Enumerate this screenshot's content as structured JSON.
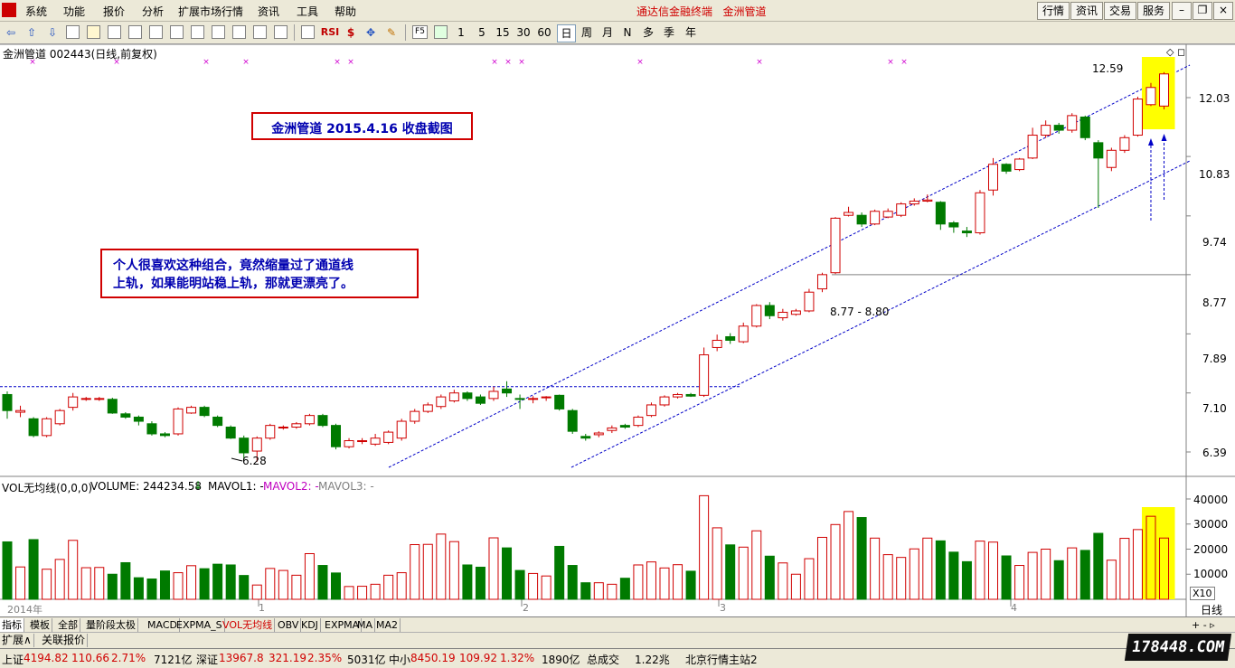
{
  "menu": [
    "系统",
    "功能",
    "报价",
    "分析",
    "扩展市场行情",
    "资讯",
    "工具",
    "帮助"
  ],
  "app_title": "通达信金融终端",
  "stock_title": "金洲管道",
  "right_buttons": [
    "行情",
    "资讯",
    "交易",
    "服务"
  ],
  "toolbar": {
    "periods": [
      "1",
      "5",
      "15",
      "30",
      "60",
      "日",
      "周",
      "月",
      "N",
      "多",
      "季",
      "年"
    ],
    "active_period": "日",
    "indicator_icon_label": "RSI",
    "f5_label": "F5"
  },
  "chart": {
    "header": "金洲管道 002443(日线,前复权)",
    "annotation_title": "金洲管道  2015.4.16  收盘截图",
    "annotation_comment_line1": "个人很喜欢这种组合，竟然缩量过了通道线",
    "annotation_comment_line2": "上轨，如果能明站稳上轨，那就更漂亮了。",
    "high_label": "12.59",
    "low_label": "6.28",
    "gap_label": "8.77 - 8.80",
    "price_ticks": [
      "12.03",
      "10.83",
      "9.74",
      "8.77",
      "7.89",
      "7.10",
      "6.39"
    ],
    "volume_header": "VOL无均线(0,0,0)",
    "volume_value_label": "VOLUME: 244234.58",
    "mavol1": "MAVOL1: -",
    "mavol2": "MAVOL2: -",
    "mavol3": "MAVOL3: -",
    "volume_ticks": [
      "40000",
      "30000",
      "20000",
      "10000"
    ],
    "vol_unit": "X10",
    "x_labels": [
      "2014年",
      "1",
      "2",
      "3",
      "4"
    ],
    "period_label": "日线"
  },
  "chart_data": {
    "type": "candlestick",
    "title": "金洲管道 002443(日线,前复权)",
    "price_axis_ticks": [
      12.03,
      10.83,
      9.74,
      8.77,
      7.89,
      7.1,
      6.39
    ],
    "volume_axis_ticks": [
      40000,
      30000,
      20000,
      10000
    ],
    "x_labels": [
      "2014年",
      "1",
      "2",
      "3",
      "4"
    ],
    "high": 12.59,
    "low": 6.28,
    "candles": [
      [
        7.08,
        6.88,
        7.12,
        6.78,
        22900
      ],
      [
        6.86,
        6.88,
        6.94,
        6.8,
        12900
      ],
      [
        6.78,
        6.58,
        6.8,
        6.56,
        23800
      ],
      [
        6.58,
        6.78,
        6.8,
        6.56,
        12000
      ],
      [
        6.72,
        6.88,
        6.9,
        6.7,
        15900
      ],
      [
        6.92,
        7.05,
        7.1,
        6.88,
        23500
      ],
      [
        7.03,
        7.03,
        7.05,
        7.0,
        12600
      ],
      [
        7.03,
        7.03,
        7.05,
        7.0,
        12700
      ],
      [
        7.02,
        6.85,
        7.04,
        6.84,
        10000
      ],
      [
        6.84,
        6.8,
        6.86,
        6.78,
        14600
      ],
      [
        6.8,
        6.75,
        6.82,
        6.7,
        8600
      ],
      [
        6.72,
        6.6,
        6.75,
        6.58,
        8100
      ],
      [
        6.6,
        6.58,
        6.62,
        6.56,
        11300
      ],
      [
        6.6,
        6.9,
        6.92,
        6.58,
        10600
      ],
      [
        6.85,
        6.92,
        6.94,
        6.84,
        13400
      ],
      [
        6.92,
        6.82,
        6.94,
        6.8,
        12200
      ],
      [
        6.8,
        6.7,
        6.82,
        6.68,
        14000
      ],
      [
        6.68,
        6.55,
        6.7,
        6.54,
        13700
      ],
      [
        6.55,
        6.38,
        6.58,
        6.3,
        9500
      ],
      [
        6.4,
        6.55,
        6.57,
        6.28,
        5700
      ],
      [
        6.55,
        6.7,
        6.72,
        6.53,
        12300
      ],
      [
        6.68,
        6.68,
        6.7,
        6.65,
        11500
      ],
      [
        6.68,
        6.72,
        6.74,
        6.66,
        9600
      ],
      [
        6.72,
        6.82,
        6.84,
        6.7,
        18200
      ],
      [
        6.82,
        6.7,
        6.84,
        6.68,
        13500
      ],
      [
        6.7,
        6.45,
        6.72,
        6.42,
        10500
      ],
      [
        6.45,
        6.52,
        6.55,
        6.43,
        5100
      ],
      [
        6.52,
        6.52,
        6.55,
        6.48,
        5200
      ],
      [
        6.48,
        6.55,
        6.6,
        6.46,
        6000
      ],
      [
        6.5,
        6.62,
        6.64,
        6.48,
        9600
      ],
      [
        6.55,
        6.75,
        6.78,
        6.52,
        10600
      ],
      [
        6.75,
        6.87,
        6.9,
        6.72,
        21800
      ],
      [
        6.87,
        6.95,
        6.98,
        6.85,
        21900
      ],
      [
        6.93,
        7.05,
        7.08,
        6.9,
        26000
      ],
      [
        7.0,
        7.1,
        7.14,
        6.98,
        23000
      ],
      [
        7.1,
        7.03,
        7.12,
        7.0,
        13700
      ],
      [
        7.05,
        6.97,
        7.08,
        6.95,
        12800
      ],
      [
        7.03,
        7.12,
        7.18,
        7.0,
        24500
      ],
      [
        7.15,
        7.1,
        7.25,
        7.05,
        20500
      ],
      [
        7.03,
        7.02,
        7.08,
        6.9,
        11500
      ],
      [
        7.02,
        7.03,
        7.06,
        6.97,
        10300
      ],
      [
        7.05,
        7.05,
        7.06,
        7.0,
        9300
      ],
      [
        7.07,
        6.9,
        7.08,
        6.88,
        21100
      ],
      [
        6.88,
        6.63,
        6.9,
        6.6,
        13500
      ],
      [
        6.57,
        6.55,
        6.6,
        6.52,
        6600
      ],
      [
        6.59,
        6.61,
        6.63,
        6.56,
        6600
      ],
      [
        6.64,
        6.67,
        6.7,
        6.61,
        6000
      ],
      [
        6.7,
        6.68,
        6.72,
        6.66,
        8400
      ],
      [
        6.7,
        6.8,
        6.82,
        6.68,
        13700
      ],
      [
        6.82,
        6.95,
        6.98,
        6.8,
        14900
      ],
      [
        6.95,
        7.05,
        7.07,
        6.93,
        12500
      ],
      [
        7.05,
        7.08,
        7.1,
        7.03,
        13800
      ],
      [
        7.08,
        7.06,
        7.1,
        7.05,
        11200
      ],
      [
        7.07,
        7.6,
        7.7,
        7.05,
        41300
      ],
      [
        7.7,
        7.8,
        7.88,
        7.65,
        28500
      ],
      [
        7.85,
        7.8,
        7.9,
        7.75,
        21700
      ],
      [
        7.78,
        8.0,
        8.05,
        7.76,
        20800
      ],
      [
        8.0,
        8.3,
        8.32,
        7.98,
        27300
      ],
      [
        8.3,
        8.15,
        8.35,
        8.1,
        17200
      ],
      [
        8.12,
        8.2,
        8.25,
        8.08,
        14500
      ],
      [
        8.17,
        8.22,
        8.25,
        8.15,
        10000
      ],
      [
        8.22,
        8.5,
        8.55,
        8.2,
        16200
      ],
      [
        8.55,
        8.77,
        8.8,
        8.5,
        24700
      ],
      [
        8.8,
        9.7,
        9.72,
        8.78,
        29800
      ],
      [
        9.75,
        9.8,
        9.9,
        9.73,
        35000
      ],
      [
        9.75,
        9.6,
        9.8,
        9.55,
        32600
      ],
      [
        9.6,
        9.82,
        9.85,
        9.58,
        24400
      ],
      [
        9.72,
        9.82,
        9.87,
        9.7,
        17800
      ],
      [
        9.75,
        9.95,
        9.98,
        9.72,
        16700
      ],
      [
        9.95,
        10.0,
        10.05,
        9.92,
        20100
      ],
      [
        10.0,
        10.02,
        10.12,
        9.98,
        24400
      ],
      [
        9.98,
        9.6,
        10.0,
        9.5,
        23300
      ],
      [
        9.62,
        9.55,
        9.65,
        9.45,
        18800
      ],
      [
        9.48,
        9.45,
        9.55,
        9.38,
        15000
      ],
      [
        9.45,
        10.15,
        10.2,
        9.42,
        23200
      ],
      [
        10.2,
        10.68,
        10.8,
        10.1,
        22800
      ],
      [
        10.68,
        10.55,
        10.7,
        10.5,
        17300
      ],
      [
        10.58,
        10.78,
        10.8,
        10.55,
        13500
      ],
      [
        10.8,
        11.25,
        11.4,
        10.78,
        18700
      ],
      [
        11.25,
        11.45,
        11.55,
        11.2,
        20000
      ],
      [
        11.45,
        11.35,
        11.5,
        11.28,
        15400
      ],
      [
        11.35,
        11.65,
        11.7,
        11.3,
        20500
      ],
      [
        11.62,
        11.2,
        11.65,
        11.15,
        19500
      ],
      [
        11.1,
        10.8,
        11.15,
        9.88,
        26300
      ],
      [
        10.62,
        10.95,
        11.0,
        10.55,
        15600
      ],
      [
        10.95,
        11.2,
        11.25,
        10.9,
        24300
      ],
      [
        11.25,
        12.0,
        12.05,
        11.22,
        27800
      ],
      [
        11.88,
        12.25,
        12.35,
        11.85,
        33100
      ],
      [
        11.85,
        12.55,
        12.59,
        11.78,
        24423
      ]
    ]
  },
  "tabs": [
    "指标",
    "模板",
    "全部",
    "量阶段太极",
    "MACD",
    "EXPMA_S",
    "VOL无均线",
    "OBV",
    "KDJ",
    "EXPMA",
    "MA",
    "MA2"
  ],
  "active_tab": "指标",
  "selected_tab": "VOL无均线",
  "row2": [
    "扩展∧",
    "关联报价"
  ],
  "status": {
    "sh_label": "上证",
    "sh_value": "4194.82",
    "sh_change": "110.66",
    "sh_pct": "2.71%",
    "sh_amount": "7121亿",
    "sz_label": "深证",
    "sz_value": "13967.8",
    "sz_change": "321.19",
    "sz_pct": "2.35%",
    "sz_amount": "5031亿",
    "zx_label": "中小",
    "zx_value": "8450.19",
    "zx_change": "109.92",
    "zx_pct": "1.32%",
    "zx_amount": "1890亿",
    "total_label": "总成交",
    "total_value": "1.22兆",
    "server": "北京行情主站2"
  },
  "watermark": "178448.COM",
  "colors": {
    "up": "#d00000",
    "down": "#007a00",
    "channel": "#0000c8",
    "highlight": "#ffff00"
  }
}
